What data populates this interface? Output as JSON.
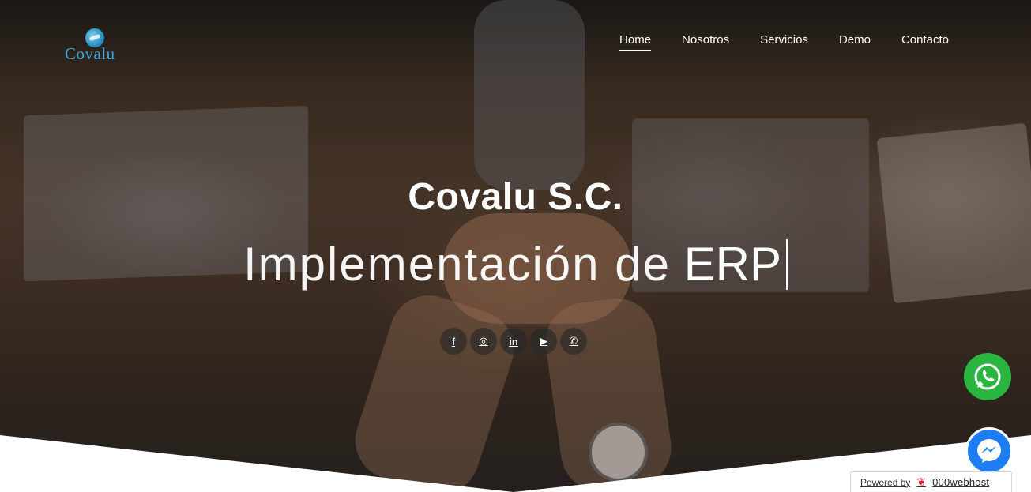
{
  "header": {
    "logo_text": "Covalu",
    "nav": [
      {
        "label": "Home",
        "active": true
      },
      {
        "label": "Nosotros",
        "active": false
      },
      {
        "label": "Servicios",
        "active": false
      },
      {
        "label": "Demo",
        "active": false
      },
      {
        "label": "Contacto",
        "active": false
      }
    ]
  },
  "hero": {
    "title": "Covalu S.C.",
    "subtitle_prefix": "Implementación de",
    "subtitle_word": "ERP"
  },
  "social": [
    {
      "name": "facebook-icon",
      "glyph": "f"
    },
    {
      "name": "instagram-icon",
      "glyph": "◎"
    },
    {
      "name": "linkedin-icon",
      "glyph": "in"
    },
    {
      "name": "youtube-icon",
      "glyph": "▶"
    },
    {
      "name": "whatsapp-icon",
      "glyph": "✆"
    }
  ],
  "floating": {
    "whatsapp_icon": "whatsapp-icon",
    "messenger_icon": "messenger-icon"
  },
  "footer_badge": {
    "powered_label": "Powered by",
    "brand": "000webhost"
  },
  "colors": {
    "logo_blue": "#3aa8dc",
    "whatsapp_green": "#2ab540",
    "messenger_blue": "#1f7df3",
    "badge_red": "#d3202f"
  }
}
